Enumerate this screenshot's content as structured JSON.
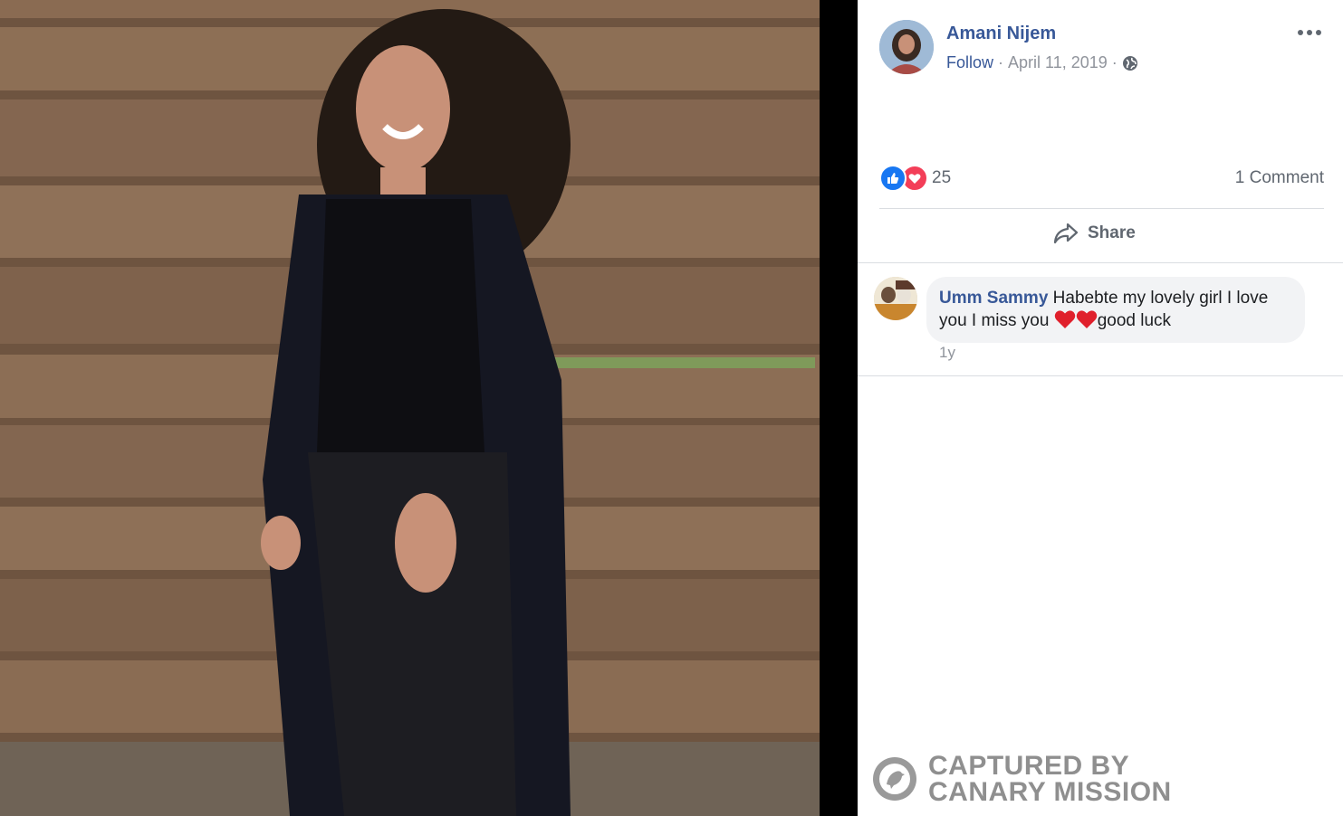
{
  "post": {
    "author_name": "Amani Nijem",
    "follow_label": "Follow",
    "separator": "·",
    "date": "April 11, 2019",
    "separator2": "·",
    "privacy_icon": "globe-icon",
    "more_icon": "more-options-icon"
  },
  "stats": {
    "reaction_icons": [
      "like-icon",
      "love-icon"
    ],
    "reaction_count": "25",
    "comment_count_label": "1 Comment"
  },
  "actions": {
    "share_label": "Share",
    "share_icon": "share-arrow-icon"
  },
  "comment": {
    "author": "Umm Sammy",
    "text_part1": "Habebte my lovely girl I love you I miss you ",
    "text_part2": "good luck",
    "time": "1y"
  },
  "watermark": {
    "line1": "CAPTURED BY",
    "line2": "CANARY MISSION"
  },
  "colors": {
    "link_blue": "#385898",
    "like_blue": "#1877f2",
    "love_red": "#f33e58",
    "wood": "#7a5e45"
  }
}
